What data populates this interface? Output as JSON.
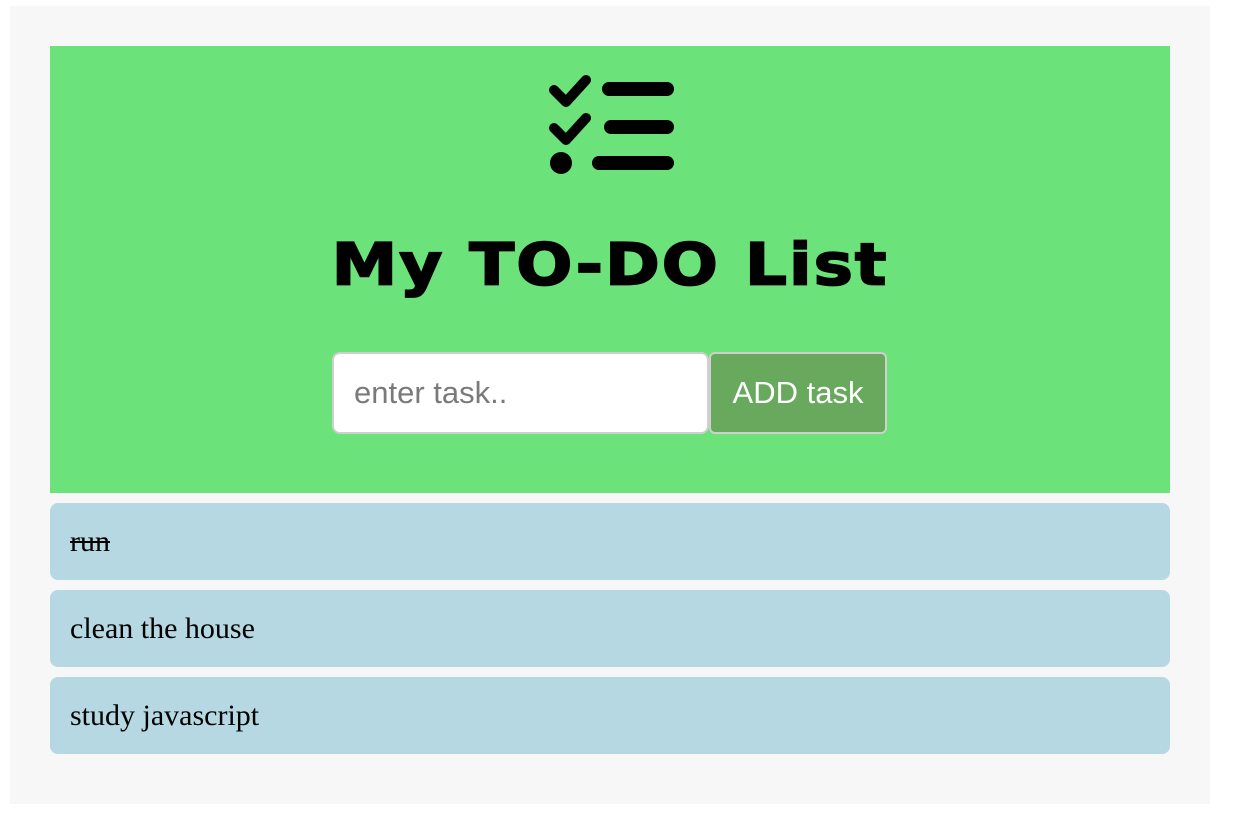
{
  "header": {
    "icon": "checklist-icon",
    "title": "My TO-DO List",
    "background_color": "#6ce27a"
  },
  "form": {
    "input_placeholder": "enter task..",
    "input_value": "",
    "add_button_label": "ADD task",
    "add_button_color": "#69a95e"
  },
  "tasks": [
    {
      "text": "run",
      "done": true
    },
    {
      "text": "clean the house",
      "done": false
    },
    {
      "text": "study javascript",
      "done": false
    }
  ],
  "colors": {
    "task_background": "#b5d8e2",
    "page_background": "#f7f7f7"
  }
}
